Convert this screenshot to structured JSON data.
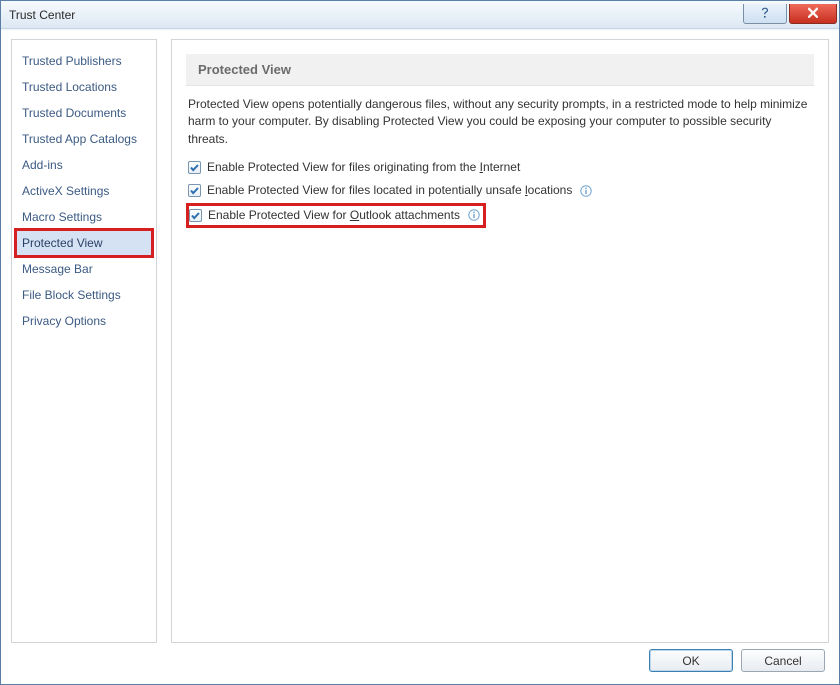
{
  "window": {
    "title": "Trust Center"
  },
  "sidebar": {
    "items": [
      {
        "label": "Trusted Publishers"
      },
      {
        "label": "Trusted Locations"
      },
      {
        "label": "Trusted Documents"
      },
      {
        "label": "Trusted App Catalogs"
      },
      {
        "label": "Add-ins"
      },
      {
        "label": "ActiveX Settings"
      },
      {
        "label": "Macro Settings"
      },
      {
        "label": "Protected View"
      },
      {
        "label": "Message Bar"
      },
      {
        "label": "File Block Settings"
      },
      {
        "label": "Privacy Options"
      }
    ],
    "selected_index": 7
  },
  "main": {
    "section_title": "Protected View",
    "description": "Protected View opens potentially dangerous files, without any security prompts, in a restricted mode to help minimize harm to your computer. By disabling Protected View you could be exposing your computer to possible security threats.",
    "options": [
      {
        "pre": "Enable Protected View for files originating from the ",
        "hot": "I",
        "post": "nternet",
        "info": false
      },
      {
        "pre": "Enable Protected View for files located in potentially unsafe ",
        "hot": "l",
        "post": "ocations",
        "info": true
      },
      {
        "pre": "Enable Protected View for ",
        "hot": "O",
        "post": "utlook attachments",
        "info": true
      }
    ]
  },
  "buttons": {
    "ok": "OK",
    "cancel": "Cancel"
  }
}
